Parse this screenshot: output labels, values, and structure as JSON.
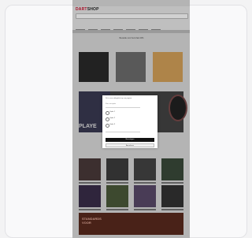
{
  "site": {
    "logo_part1": "DART",
    "logo_part2": "SHOP",
    "banner": "Bestelde voor Kerst fast 20%"
  },
  "hero": {
    "text": "PLAYE"
  },
  "promo": {
    "line1": "STANDARDS",
    "line2": "VOOR"
  },
  "modal": {
    "title": "Dit is een uitlegtekst op uw pagina",
    "subtitle": "Kies uw optie",
    "options": [
      "Optie 1",
      "Optie 2",
      "Optie 3"
    ],
    "confirm_label": "Bevestigen",
    "cancel_label": "Annuleren"
  }
}
